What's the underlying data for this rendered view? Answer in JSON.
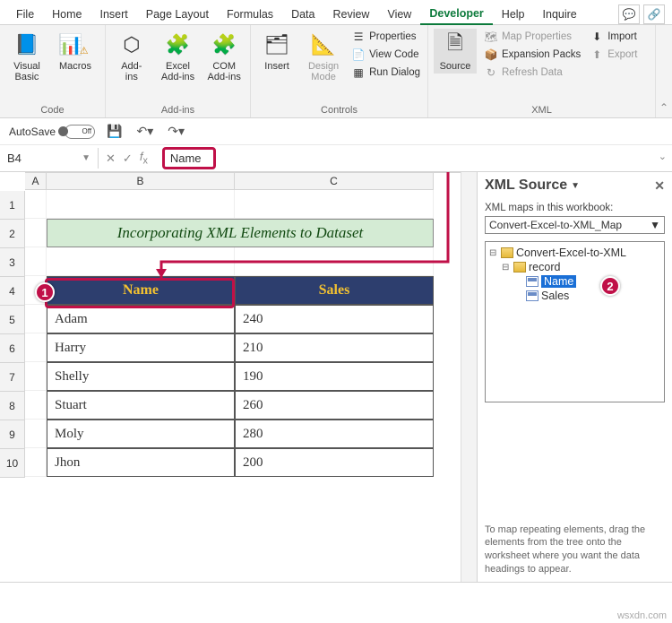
{
  "tabs": [
    "File",
    "Home",
    "Insert",
    "Page Layout",
    "Formulas",
    "Data",
    "Review",
    "View",
    "Developer",
    "Help",
    "Inquire"
  ],
  "active_tab": "Developer",
  "ribbon": {
    "code": {
      "label": "Code",
      "visual_basic": "Visual\nBasic",
      "macros": "Macros"
    },
    "addins": {
      "label": "Add-ins",
      "addins": "Add-\nins",
      "excel": "Excel\nAdd-ins",
      "com": "COM\nAdd-ins"
    },
    "controls": {
      "label": "Controls",
      "insert": "Insert",
      "design": "Design\nMode",
      "properties": "Properties",
      "viewcode": "View Code",
      "rundlg": "Run Dialog"
    },
    "xml": {
      "label": "XML",
      "source": "Source",
      "mapprops": "Map Properties",
      "expansion": "Expansion Packs",
      "refresh": "Refresh Data",
      "import": "Import",
      "export": "Export"
    }
  },
  "qat": {
    "autosave": "AutoSave",
    "state": "Off"
  },
  "formula_bar": {
    "cellref": "B4",
    "value": "Name"
  },
  "col_headers": [
    "A",
    "B",
    "C"
  ],
  "row_headers": [
    "1",
    "2",
    "3",
    "4",
    "5",
    "6",
    "7",
    "8",
    "9",
    "10"
  ],
  "sheet": {
    "title": "Incorporating XML Elements to Dataset",
    "headers": {
      "b": "Name",
      "c": "Sales"
    },
    "rows": [
      {
        "name": "Adam",
        "sales": "240"
      },
      {
        "name": "Harry",
        "sales": "210"
      },
      {
        "name": "Shelly",
        "sales": "190"
      },
      {
        "name": "Stuart",
        "sales": "260"
      },
      {
        "name": "Moly",
        "sales": "280"
      },
      {
        "name": "Jhon",
        "sales": "200"
      }
    ]
  },
  "xmlpane": {
    "title": "XML Source",
    "subtitle": "XML maps in this workbook:",
    "selected_map": "Convert-Excel-to-XML_Map",
    "tree": {
      "root": "Convert-Excel-to-XML",
      "child": "record",
      "leaf1": "Name",
      "leaf2": "Sales"
    },
    "hint": "To map repeating elements, drag the elements from the tree onto the worksheet where you want the data headings to appear."
  },
  "callouts": {
    "one": "1",
    "two": "2"
  },
  "watermark": "wsxdn.com"
}
